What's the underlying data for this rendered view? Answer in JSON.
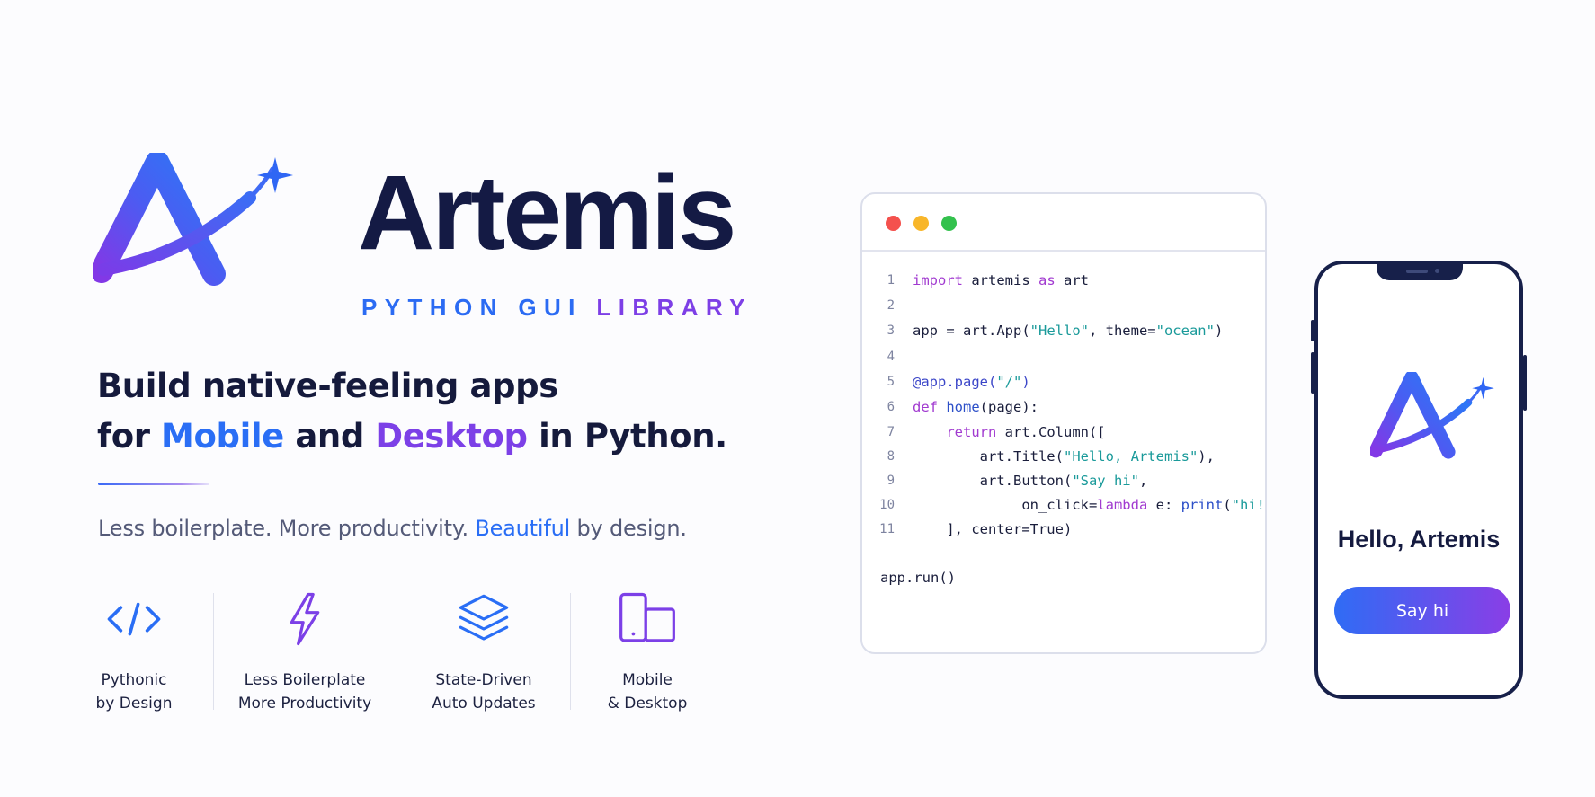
{
  "brand": {
    "name": "Artemis",
    "tagline_part1": "PYTHON GUI",
    "tagline_part2": "LIBRARY",
    "logo_icon": "artemis-logo-icon"
  },
  "headline": {
    "line1": "Build native-feeling apps",
    "line2_prefix": "for ",
    "mobile": "Mobile",
    "and": " and ",
    "desktop": "Desktop",
    "line2_suffix": " in Python."
  },
  "subline": {
    "part1": "Less boilerplate. More productivity. ",
    "highlight": "Beautiful",
    "part2": " by design."
  },
  "features": [
    {
      "icon": "code-brackets-icon",
      "line1": "Pythonic",
      "line2": "by Design"
    },
    {
      "icon": "lightning-bolt-icon",
      "line1": "Less Boilerplate",
      "line2": "More Productivity"
    },
    {
      "icon": "layers-icon",
      "line1": "State-Driven",
      "line2": "Auto Updates"
    },
    {
      "icon": "devices-icon",
      "line1": "Mobile",
      "line2": "& Desktop"
    }
  ],
  "code": {
    "lines": [
      {
        "n": "1",
        "tokens": [
          [
            "kw",
            "import"
          ],
          [
            "",
            " artemis "
          ],
          [
            "kw",
            "as"
          ],
          [
            "",
            " art"
          ]
        ]
      },
      {
        "n": "2",
        "tokens": []
      },
      {
        "n": "3",
        "tokens": [
          [
            "",
            "app = art.App("
          ],
          [
            "str",
            "\"Hello\""
          ],
          [
            "",
            ", theme="
          ],
          [
            "str",
            "\"ocean\""
          ],
          [
            "",
            ")"
          ]
        ]
      },
      {
        "n": "4",
        "tokens": []
      },
      {
        "n": "5",
        "tokens": [
          [
            "dec",
            "@app.page("
          ],
          [
            "str",
            "\"/\""
          ],
          [
            "dec",
            ")"
          ]
        ]
      },
      {
        "n": "6",
        "tokens": [
          [
            "kw",
            "def"
          ],
          [
            "",
            " "
          ],
          [
            "fn",
            "home"
          ],
          [
            "",
            "(page):"
          ]
        ]
      },
      {
        "n": "7",
        "tokens": [
          [
            "",
            "    "
          ],
          [
            "kw",
            "return"
          ],
          [
            "",
            " art.Column(["
          ]
        ]
      },
      {
        "n": "8",
        "tokens": [
          [
            "",
            "        art.Title("
          ],
          [
            "str",
            "\"Hello, Artemis\""
          ],
          [
            "",
            "),"
          ]
        ]
      },
      {
        "n": "9",
        "tokens": [
          [
            "",
            "        art.Button("
          ],
          [
            "str",
            "\"Say hi\""
          ],
          [
            "",
            ","
          ]
        ]
      },
      {
        "n": "10",
        "tokens": [
          [
            "",
            "             on_click="
          ],
          [
            "kw",
            "lambda"
          ],
          [
            "",
            " e: "
          ],
          [
            "fn",
            "print"
          ],
          [
            "",
            "("
          ],
          [
            "str",
            "\"hi!\""
          ],
          [
            "",
            ")),"
          ]
        ]
      },
      {
        "n": "11",
        "tokens": [
          [
            "",
            "    ], center=True)"
          ]
        ]
      },
      {
        "n": "",
        "tokens": []
      },
      {
        "n": "",
        "tokens": [
          [
            "",
            "app.run()"
          ]
        ]
      }
    ]
  },
  "phone": {
    "title": "Hello, Artemis",
    "button_label": "Say hi"
  },
  "colors": {
    "blue": "#2a6ef5",
    "purple": "#7c40e7",
    "navy": "#141a44",
    "dot_red": "#f4514d",
    "dot_yellow": "#f8b62a",
    "dot_green": "#33c14d"
  }
}
